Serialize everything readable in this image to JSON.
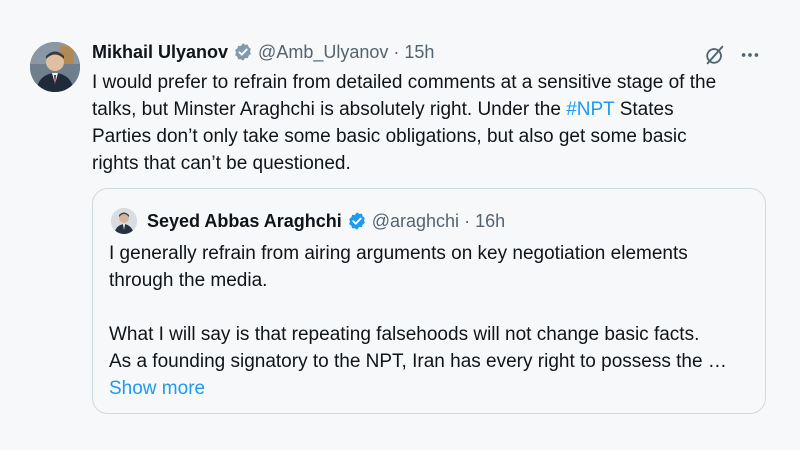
{
  "tweet": {
    "author_name": "Mikhail Ulyanov",
    "handle": "@Amb_Ulyanov",
    "separator": "·",
    "time": "15h",
    "icons": {
      "avatar": "profile-photo",
      "verified": "verified-badge-icon",
      "grok": "grok-icon",
      "more": "more-options-icon"
    },
    "text_lines": [
      "I would prefer to refrain from detailed comments at a sensitive stage of the",
      "talks, but Minster Araghchi is absolutely right. Under the ",
      "#NPT",
      " States",
      "Parties don’t only take some basic obligations, but also get some basic",
      "rights that can’t be questioned."
    ]
  },
  "quoted_tweet": {
    "author_name": "Seyed Abbas Araghchi",
    "handle": "@araghchi",
    "separator": "·",
    "time": "16h",
    "text_lines": [
      "I generally refrain from airing arguments on key negotiation elements",
      "through the media.",
      "What I will say is that repeating falsehoods will not change basic facts.",
      "As a founding signatory to the NPT, Iran has every right to possess the …"
    ],
    "show_more_label": "Show more"
  },
  "colors": {
    "accent": "#1d9bf0",
    "secondary_text": "#536471",
    "border": "#cfd9de",
    "background": "#f7f8f9"
  }
}
